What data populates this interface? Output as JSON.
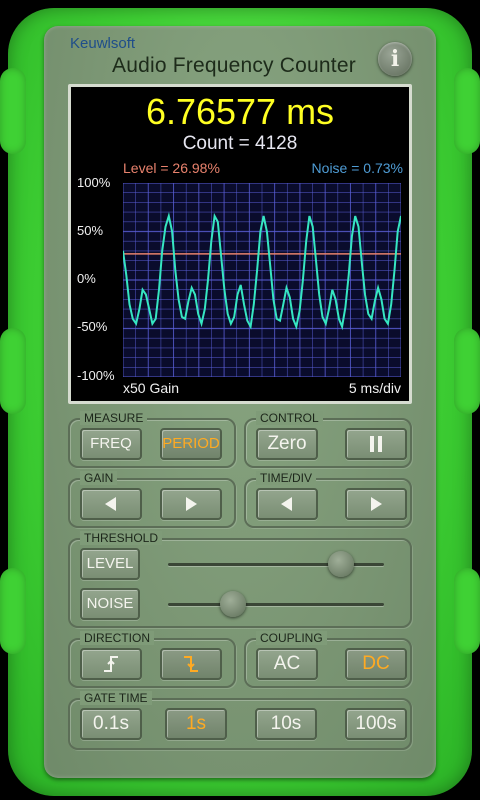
{
  "header": {
    "brand": "Keuwlsoft",
    "title": "Audio Frequency Counter",
    "info_icon_glyph": "i"
  },
  "display": {
    "reading": "6.76577 ms",
    "count": "Count = 4128",
    "level": "Level = 26.98%",
    "noise": "Noise = 0.73%",
    "y_ticks": [
      "100%",
      "50%",
      "0%",
      "-50%",
      "-100%"
    ],
    "gain": "x50 Gain",
    "timebase": "5 ms/div",
    "colors": {
      "reading": "#ffff22",
      "level": "#e8826d",
      "noise": "#4f9dd6",
      "trace": "#36e6c2",
      "grid": "#5a5fd8"
    }
  },
  "chart_data": {
    "type": "line",
    "ylim": [
      -100,
      100
    ],
    "level_percent": 26.98,
    "noise_percent": 0.73,
    "series": [
      {
        "values": [
          30,
          5,
          -25,
          -40,
          -45,
          -30,
          -10,
          -15,
          -30,
          -45,
          -40,
          -10,
          30,
          55,
          66,
          50,
          10,
          -20,
          -38,
          -40,
          -22,
          -8,
          -15,
          -35,
          -45,
          -30,
          0,
          40,
          66,
          60,
          25,
          -10,
          -35,
          -45,
          -38,
          -15,
          -5,
          -25,
          -42,
          -48,
          -25,
          10,
          50,
          66,
          50,
          15,
          -20,
          -40,
          -42,
          -25,
          -8,
          -18,
          -40,
          -48,
          -32,
          0,
          40,
          66,
          55,
          20,
          -15,
          -38,
          -45,
          -30,
          -10,
          -20,
          -40,
          -48,
          -28,
          5,
          45,
          66,
          55,
          18,
          -15,
          -35,
          -40,
          -22,
          -8,
          -20,
          -40,
          -45,
          -25,
          10,
          50,
          66
        ]
      }
    ]
  },
  "controls": {
    "measure": {
      "label": "MEASURE",
      "buttons": [
        "FREQ",
        "PERIOD"
      ],
      "active": "PERIOD"
    },
    "control": {
      "label": "CONTROL",
      "zero": "Zero",
      "pause_icon": "pause-icon"
    },
    "gain": {
      "label": "GAIN",
      "left_icon": "triangle-left-icon",
      "right_icon": "triangle-right-icon"
    },
    "timediv": {
      "label": "TIME/DIV",
      "left_icon": "triangle-left-icon",
      "right_icon": "triangle-right-icon"
    },
    "threshold": {
      "label": "THRESHOLD",
      "level": "LEVEL",
      "noise": "NOISE",
      "level_slider_fraction": 0.8,
      "noise_slider_fraction": 0.3
    },
    "direction": {
      "label": "DIRECTION",
      "rising_icon": "rising-edge-icon",
      "falling_icon": "falling-edge-icon",
      "active": "falling"
    },
    "coupling": {
      "label": "COUPLING",
      "buttons": [
        "AC",
        "DC"
      ],
      "active": "DC"
    },
    "gate": {
      "label": "GATE TIME",
      "buttons": [
        "0.1s",
        "1s",
        "10s",
        "100s"
      ],
      "active": "1s"
    }
  },
  "accent_color": "#ffaa22",
  "case_color": "#3fd134"
}
